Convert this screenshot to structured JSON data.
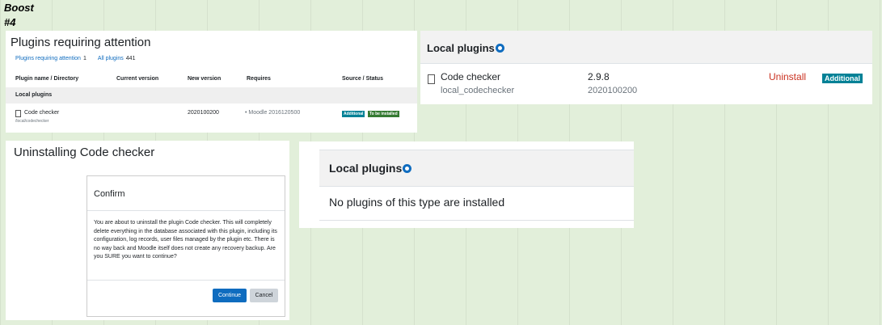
{
  "theme": {
    "label": "Boost",
    "sublabel": "#4"
  },
  "panel1": {
    "title": "Plugins requiring attention",
    "filter_attention": "Plugins requiring attention",
    "filter_attention_count": "1",
    "filter_all": "All plugins",
    "filter_all_count": "441",
    "columns": [
      "Plugin name / Directory",
      "Current version",
      "New version",
      "Requires",
      "Source / Status"
    ],
    "group": "Local plugins",
    "row": {
      "name": "Code checker",
      "dir": "/local/codechecker",
      "new_version": "2020100200",
      "requires": "• Moodle 2016120500",
      "badge_source": "Additional",
      "badge_status": "To be installed"
    }
  },
  "panel2": {
    "title": "Local plugins",
    "name": "Code checker",
    "dir": "local_codechecker",
    "version": "2.9.8",
    "build": "2020100200",
    "uninstall": "Uninstall",
    "badge": "Additional"
  },
  "panel3": {
    "title": "Uninstalling Code checker",
    "modal_title": "Confirm",
    "modal_body": "You are about to uninstall the plugin Code checker. This will completely delete everything in the database associated with this plugin, including its configuration, log records, user files managed by the plugin etc. There is no way back and Moodle itself does not create any recovery backup. Are you SURE you want to continue?",
    "continue": "Continue",
    "cancel": "Cancel"
  },
  "panel4": {
    "title": "Local plugins",
    "message": "No plugins of this type are installed"
  },
  "icons": {
    "settings": "gear-icon",
    "plugin": "file-icon"
  }
}
